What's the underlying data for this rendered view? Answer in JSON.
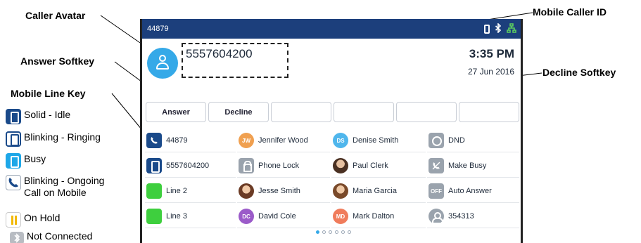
{
  "callouts": {
    "caller_avatar": "Caller Avatar",
    "mobile_caller_id": "Mobile Caller ID",
    "answer_softkey": "Answer Softkey",
    "decline_softkey": "Decline Softkey",
    "mobile_line_key": "Mobile Line Key"
  },
  "legend": [
    {
      "icon": "mobile-solid-icon",
      "text": "Solid - Idle"
    },
    {
      "icon": "mobile-outline-icon",
      "text": "Blinking - Ringing"
    },
    {
      "icon": "mobile-busy-icon",
      "text": "Busy"
    },
    {
      "icon": "phone-handset-icon",
      "text": "Blinking - Ongoing",
      "text2": "Call on Mobile"
    },
    {
      "icon": "hold-icon",
      "text": "On Hold"
    },
    {
      "icon": "bluetooth-icon",
      "text": "Not Connected"
    }
  ],
  "status_bar": {
    "extension": "44879",
    "icons": [
      "mobile-icon",
      "bluetooth-icon",
      "network-icon"
    ],
    "color": "#1c3f7c"
  },
  "caller": {
    "number": "5557604200",
    "time": "3:35 PM",
    "date": "27 Jun 2016"
  },
  "softkeys": [
    "Answer",
    "Decline",
    "",
    "",
    "",
    ""
  ],
  "line_keys": [
    {
      "icon": "phone-handset-icon",
      "initials": "",
      "label": "44879"
    },
    {
      "icon": "avatar-initials-icon",
      "initials": "JW",
      "label": "Jennifer Wood"
    },
    {
      "icon": "avatar-initials-icon",
      "initials": "DS",
      "label": "Denise Smith"
    },
    {
      "icon": "dnd-icon",
      "initials": "",
      "label": "DND"
    },
    {
      "icon": "mobile-solid-icon",
      "initials": "",
      "label": "5557604200"
    },
    {
      "icon": "lock-icon",
      "initials": "",
      "label": "Phone Lock"
    },
    {
      "icon": "contact-photo-icon",
      "initials": "",
      "label": "Paul Clerk"
    },
    {
      "icon": "make-busy-icon",
      "initials": "",
      "label": "Make Busy"
    },
    {
      "icon": "line-green-icon",
      "initials": "",
      "label": "Line 2"
    },
    {
      "icon": "contact-photo-icon",
      "initials": "",
      "label": "Jesse Smith"
    },
    {
      "icon": "contact-photo-icon",
      "initials": "",
      "label": "Maria Garcia"
    },
    {
      "icon": "off-icon",
      "initials": "OFF",
      "label": "Auto Answer"
    },
    {
      "icon": "line-green-icon",
      "initials": "",
      "label": "Line 3"
    },
    {
      "icon": "avatar-initials-icon",
      "initials": "DC",
      "label": "David Cole"
    },
    {
      "icon": "avatar-initials-icon",
      "initials": "MD",
      "label": "Mark Dalton"
    },
    {
      "icon": "person-icon",
      "initials": "",
      "label": "354313"
    }
  ],
  "pager": {
    "pages": 6,
    "current": 1
  }
}
